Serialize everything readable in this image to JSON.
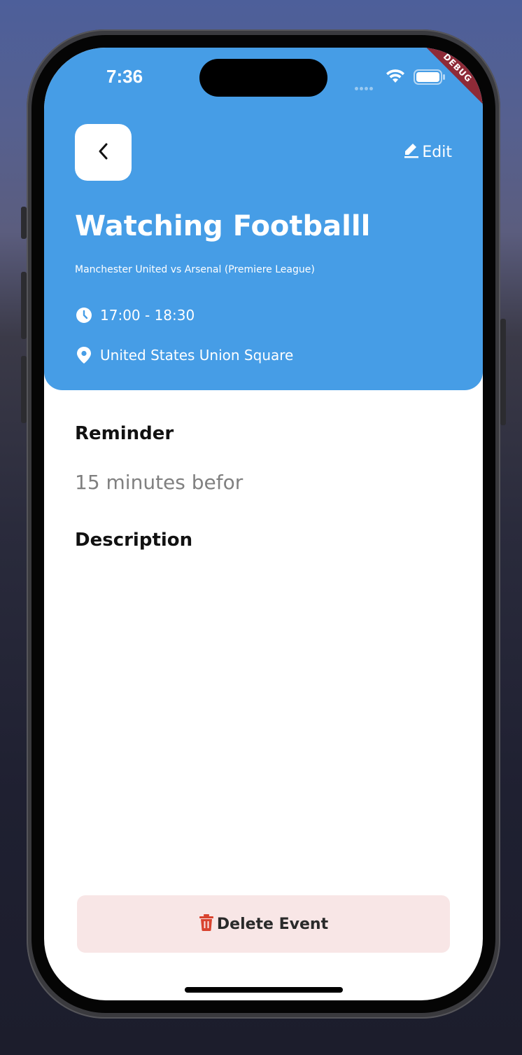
{
  "status_bar": {
    "time": "7:36",
    "debug_label": "DEBUG"
  },
  "header": {
    "back_icon": "chevron-left-icon",
    "edit_label": "Edit",
    "edit_icon": "pencil-icon",
    "title": "Watching Footballl",
    "subtitle": "Manchester United vs Arsenal (Premiere League)",
    "time_range": "17:00 - 18:30",
    "time_icon": "clock-icon",
    "location": "United States Union Square",
    "location_icon": "map-pin-icon",
    "background_color": "#469de6"
  },
  "reminder": {
    "heading": "Reminder",
    "value": "15 minutes befor"
  },
  "description": {
    "heading": "Description",
    "text": ""
  },
  "actions": {
    "delete_label": "Delete Event",
    "delete_icon": "trash-icon",
    "delete_icon_color": "#d9432f",
    "delete_bg_color": "#f8e6e6"
  }
}
